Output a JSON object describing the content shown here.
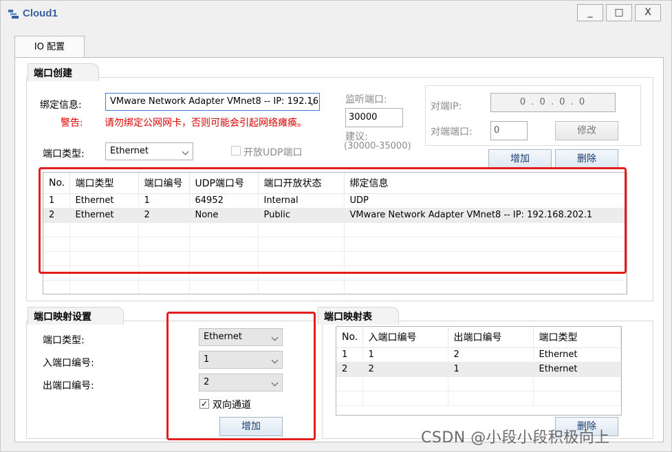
{
  "window": {
    "title": "Cloud1",
    "minimize": "_",
    "maximize": "□",
    "close": "X"
  },
  "tab": {
    "label": "IO 配置"
  },
  "port_create": {
    "title": "端口创建",
    "bind_label": "绑定信息:",
    "bind_value": "VMware Network Adapter VMnet8 -- IP: 192.16",
    "warn_label": "警告:",
    "warn_text": "请勿绑定公网网卡，否则可能会引起网络瘫痪。",
    "type_label": "端口类型:",
    "type_value": "Ethernet",
    "udp_label": "开放UDP端口",
    "listen_label": "监听端口:",
    "listen_value": "30000",
    "suggest_label": "建议:",
    "suggest_range": "(30000-35000)",
    "peer_ip_label": "对端IP:",
    "peer_ip_parts": [
      "0",
      "0",
      "0",
      "0"
    ],
    "peer_port_label": "对端端口:",
    "peer_port_value": "0",
    "modify_btn": "修改",
    "add_btn": "增加",
    "delete_btn": "删除"
  },
  "port_table": {
    "headers": [
      "No.",
      "端口类型",
      "端口编号",
      "UDP端口号",
      "端口开放状态",
      "绑定信息"
    ],
    "rows": [
      [
        "1",
        "Ethernet",
        "1",
        "64952",
        "Internal",
        "UDP"
      ],
      [
        "2",
        "Ethernet",
        "2",
        "None",
        "Public",
        "VMware Network Adapter VMnet8 -- IP: 192.168.202.1"
      ]
    ]
  },
  "mapping_settings": {
    "title": "端口映射设置",
    "type_label": "端口类型:",
    "type_value": "Ethernet",
    "in_label": "入端口编号:",
    "in_value": "1",
    "out_label": "出端口编号:",
    "out_value": "2",
    "bidir_label": "双向通道",
    "bidir_checked": "✓",
    "add_btn": "增加"
  },
  "mapping_table": {
    "title": "端口映射表",
    "headers": [
      "No.",
      "入端口编号",
      "出端口编号",
      "端口类型"
    ],
    "rows": [
      [
        "1",
        "1",
        "2",
        "Ethernet"
      ],
      [
        "2",
        "2",
        "1",
        "Ethernet"
      ]
    ],
    "delete_btn": "删除"
  },
  "watermark": "CSDN @小段小段积极向上",
  "colors": {
    "highlight_box": "#e51c1c",
    "warning_text": "#e00000",
    "title_blue": "#3a5fa0"
  }
}
